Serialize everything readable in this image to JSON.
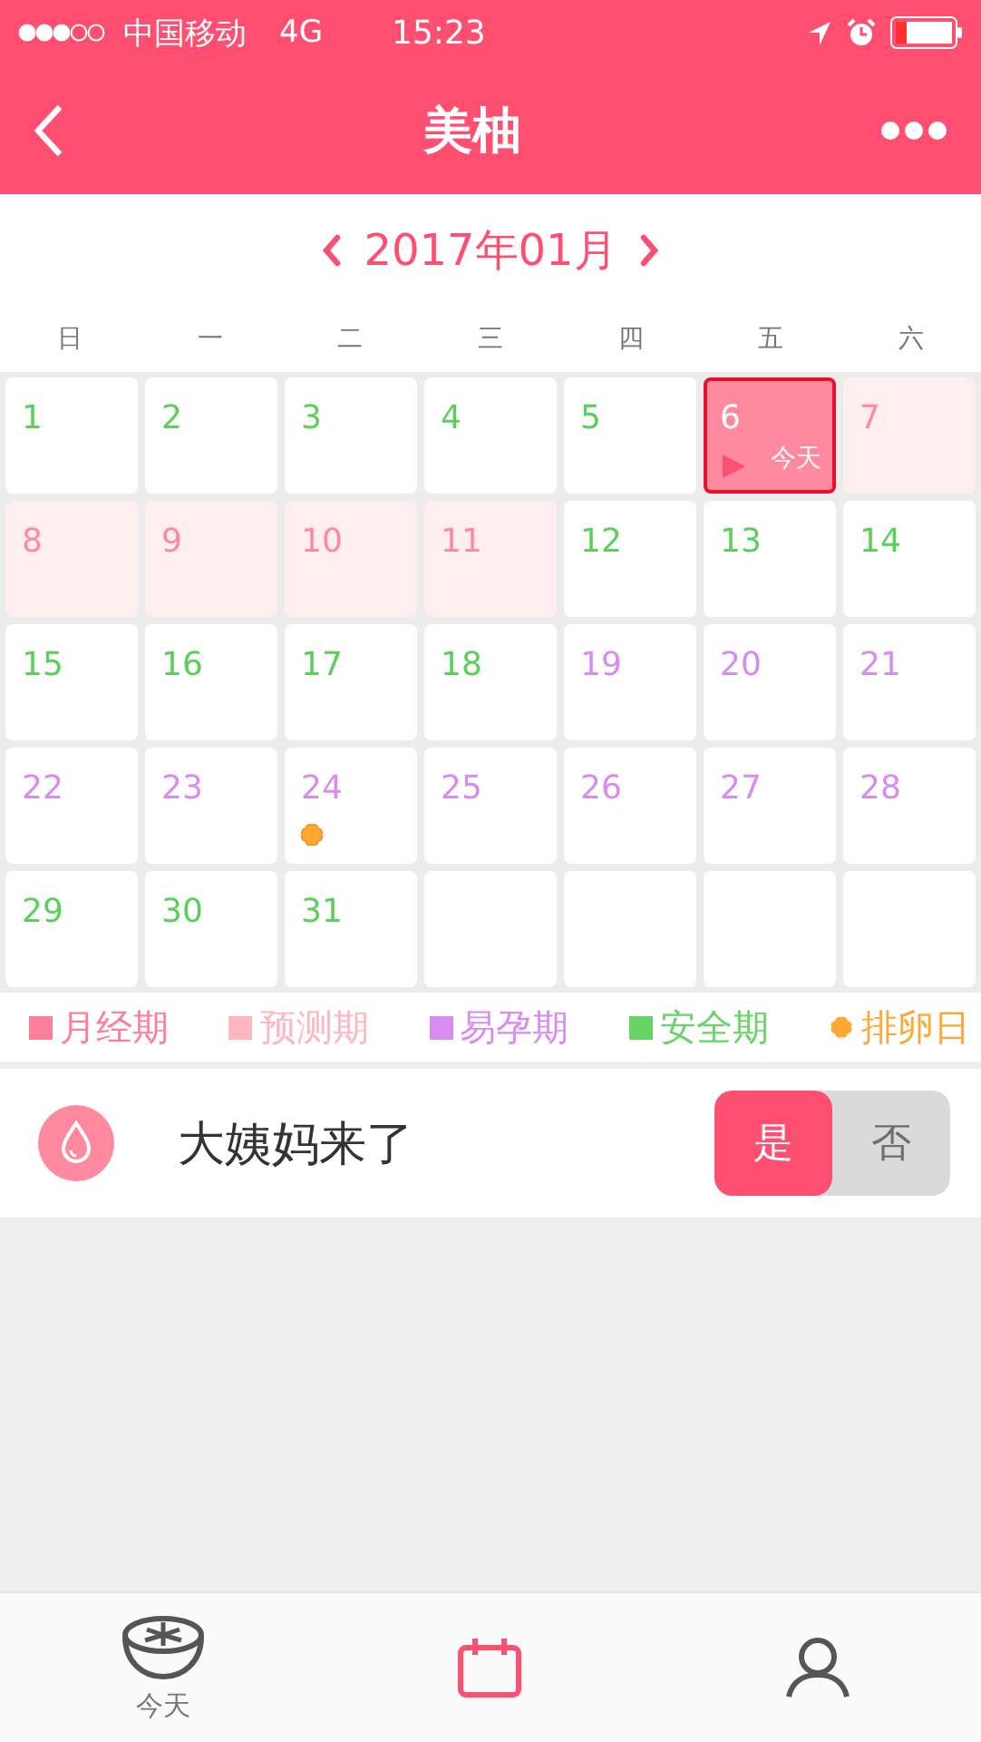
{
  "status_bar": {
    "carrier": "中国移动",
    "network": "4G",
    "time": "15:23"
  },
  "nav_bar": {
    "title": "美柚"
  },
  "calendar": {
    "month": "2017年01月",
    "weekdays": [
      "日",
      "一",
      "二",
      "三",
      "四",
      "五",
      "六"
    ],
    "days": [
      {
        "day": "1",
        "kind": "safe",
        "selected": false,
        "ovulation": false
      },
      {
        "day": "2",
        "kind": "safe",
        "selected": false,
        "ovulation": false
      },
      {
        "day": "3",
        "kind": "safe",
        "selected": false,
        "ovulation": false
      },
      {
        "day": "4",
        "kind": "safe",
        "selected": false,
        "ovulation": false
      },
      {
        "day": "5",
        "kind": "safe",
        "selected": false,
        "ovulation": false
      },
      {
        "day": "6",
        "kind": "menstrual",
        "selected": true,
        "ovulation": false,
        "today_label": "今天"
      },
      {
        "day": "7",
        "kind": "predicted",
        "selected": false,
        "ovulation": false
      },
      {
        "day": "8",
        "kind": "predicted",
        "selected": false,
        "ovulation": false
      },
      {
        "day": "9",
        "kind": "predicted",
        "selected": false,
        "ovulation": false
      },
      {
        "day": "10",
        "kind": "predicted",
        "selected": false,
        "ovulation": false
      },
      {
        "day": "11",
        "kind": "predicted",
        "selected": false,
        "ovulation": false
      },
      {
        "day": "12",
        "kind": "safe",
        "selected": false,
        "ovulation": false
      },
      {
        "day": "13",
        "kind": "safe",
        "selected": false,
        "ovulation": false
      },
      {
        "day": "14",
        "kind": "safe",
        "selected": false,
        "ovulation": false
      },
      {
        "day": "15",
        "kind": "safe",
        "selected": false,
        "ovulation": false
      },
      {
        "day": "16",
        "kind": "safe",
        "selected": false,
        "ovulation": false
      },
      {
        "day": "17",
        "kind": "safe",
        "selected": false,
        "ovulation": false
      },
      {
        "day": "18",
        "kind": "safe",
        "selected": false,
        "ovulation": false
      },
      {
        "day": "19",
        "kind": "fertile",
        "selected": false,
        "ovulation": false
      },
      {
        "day": "20",
        "kind": "fertile",
        "selected": false,
        "ovulation": false
      },
      {
        "day": "21",
        "kind": "fertile",
        "selected": false,
        "ovulation": false
      },
      {
        "day": "22",
        "kind": "fertile",
        "selected": false,
        "ovulation": false
      },
      {
        "day": "23",
        "kind": "fertile",
        "selected": false,
        "ovulation": false
      },
      {
        "day": "24",
        "kind": "fertile",
        "selected": false,
        "ovulation": true
      },
      {
        "day": "25",
        "kind": "fertile",
        "selected": false,
        "ovulation": false
      },
      {
        "day": "26",
        "kind": "fertile",
        "selected": false,
        "ovulation": false
      },
      {
        "day": "27",
        "kind": "fertile",
        "selected": false,
        "ovulation": false
      },
      {
        "day": "28",
        "kind": "fertile",
        "selected": false,
        "ovulation": false
      },
      {
        "day": "29",
        "kind": "safe",
        "selected": false,
        "ovulation": false
      },
      {
        "day": "30",
        "kind": "safe",
        "selected": false,
        "ovulation": false
      },
      {
        "day": "31",
        "kind": "safe",
        "selected": false,
        "ovulation": false
      }
    ]
  },
  "legend": [
    {
      "label": "月经期",
      "kind": "square",
      "color": "#ff7f9a"
    },
    {
      "label": "预测期",
      "kind": "square",
      "color": "#ffb6c1"
    },
    {
      "label": "易孕期",
      "kind": "square",
      "color": "#d98cf0"
    },
    {
      "label": "安全期",
      "kind": "square",
      "color": "#66d466"
    },
    {
      "label": "排卵日",
      "kind": "flower",
      "color": "#ffa733"
    }
  ],
  "period_row": {
    "label": "大姨妈来了",
    "options": [
      {
        "label": "是",
        "selected": true
      },
      {
        "label": "否",
        "selected": false
      }
    ]
  },
  "tab_bar": {
    "tabs": [
      {
        "label": "今天",
        "selected": false
      }
    ]
  }
}
